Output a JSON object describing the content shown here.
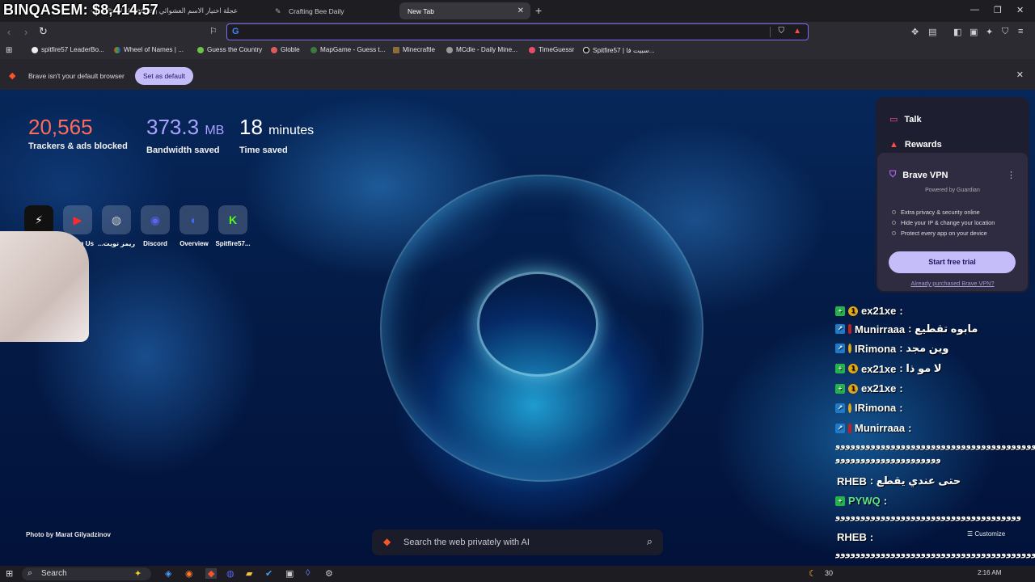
{
  "overlay": {
    "streamer_text": "BINQASEM: $8,414.57"
  },
  "tabs": [
    {
      "label": "Wheel of Names | عجلة اختيار الاسم العشوائي",
      "active": false
    },
    {
      "label": "Crafting Bee Daily",
      "active": false
    },
    {
      "label": "New Tab",
      "active": true
    }
  ],
  "toolbar": {
    "url_value": "",
    "icons": [
      "back-icon",
      "forward-icon",
      "reload-icon",
      "bookmark-icon",
      "brave-shields-icon",
      "brave-rewards-icon",
      "extensions-icon",
      "sidebar-icon",
      "wallet-icon",
      "leo-ai-icon",
      "vpn-icon",
      "menu-icon"
    ]
  },
  "bookmarks": [
    "spitfire57 LeaderBo...",
    "Wheel of Names | ...",
    "Guess the Country",
    "Globle",
    "MapGame - Guess t...",
    "Minecraftle",
    "MCdle - Daily Mine...",
    "TimeGuessr",
    "Spitfire57 | سبيت فا..."
  ],
  "infobar": {
    "message": "Brave isn't your default browser",
    "button": "Set as default"
  },
  "stats": {
    "trackers": {
      "value": "20,565",
      "label": "Trackers & ads blocked",
      "color": "#ff6b5b"
    },
    "bandwidth": {
      "value": "373.3",
      "unit": "MB",
      "label": "Bandwidth saved",
      "color": "#a9a3ff"
    },
    "time": {
      "value": "18",
      "unit": "minutes",
      "label": "Time saved",
      "color": "#ffffff"
    }
  },
  "top_sites": [
    {
      "label": "",
      "icon": "bolt-icon"
    },
    {
      "label": "Among Us",
      "icon": "youtube-icon"
    },
    {
      "label": "...ريمز تويت",
      "icon": "globe-icon"
    },
    {
      "label": "Discord",
      "icon": "discord-icon"
    },
    {
      "label": "Overview",
      "icon": "overview-icon"
    },
    {
      "label": "Spitfire57...",
      "icon": "kick-icon"
    }
  ],
  "photo_credit": "Photo by Marat Gilyadzinov",
  "search": {
    "placeholder": "Search the web privately with AI"
  },
  "customize": "Customize",
  "widgets": {
    "talk": "Talk",
    "rewards": "Rewards",
    "vpn": {
      "title": "Brave VPN",
      "powered_by": "Powered by Guardian",
      "features": [
        "Extra privacy & security online",
        "Hide your IP & change your location",
        "Protect every app on your device"
      ],
      "cta": "Start free trial",
      "already": "Already purchased Brave VPN?"
    }
  },
  "chat": [
    {
      "user": "ex21xe",
      "text": ":"
    },
    {
      "user": "Munirraaa",
      "text": ": مابوه تقطيع"
    },
    {
      "user": "IRimona",
      "text": ": وين مجد"
    },
    {
      "user": "ex21xe",
      "text": ": لا مو ذا"
    },
    {
      "user": "ex21xe",
      "text": ":"
    },
    {
      "user": "IRimona",
      "text": ":"
    },
    {
      "user": "Munirraaa",
      "text": ":"
    },
    {
      "user": "",
      "text": "ﻭﻭﻭﻭﻭﻭﻭﻭﻭﻭﻭﻭﻭﻭﻭﻭﻭﻭﻭﻭﻭﻭﻭﻭﻭﻭﻭﻭﻭﻭﻭﻭﻭﻭﻭﻭﻭﻭﻭﻭﻭ"
    },
    {
      "user": "",
      "text": "ﻭﻭﻭﻭﻭﻭﻭﻭﻭﻭﻭﻭﻭﻭﻭﻭﻭﻭﻭﻭﻭ"
    },
    {
      "user": "RHEB",
      "text": ": حتى عندي يقطع"
    },
    {
      "user": "PYWQ",
      "text": ":"
    },
    {
      "user": "",
      "text": "ﻭﻭﻭﻭﻭﻭﻭﻭﻭﻭﻭﻭﻭﻭﻭﻭﻭﻭﻭﻭﻭﻭﻭﻭﻭﻭﻭﻭﻭﻭﻭﻭﻭﻭﻭﻭﻭ"
    },
    {
      "user": "RHEB",
      "text": ":"
    },
    {
      "user": "",
      "text": "ﻭﻭﻭﻭﻭﻭﻭﻭﻭﻭﻭﻭﻭﻭﻭﻭﻭﻭﻭﻭﻭﻭﻭﻭﻭﻭﻭﻭﻭﻭﻭﻭﻭﻭﻭﻭﻭﻭﻭﻭﻭ"
    }
  ],
  "taskbar": {
    "search": "Search",
    "temperature": "30",
    "clock": "2:16 AM"
  }
}
